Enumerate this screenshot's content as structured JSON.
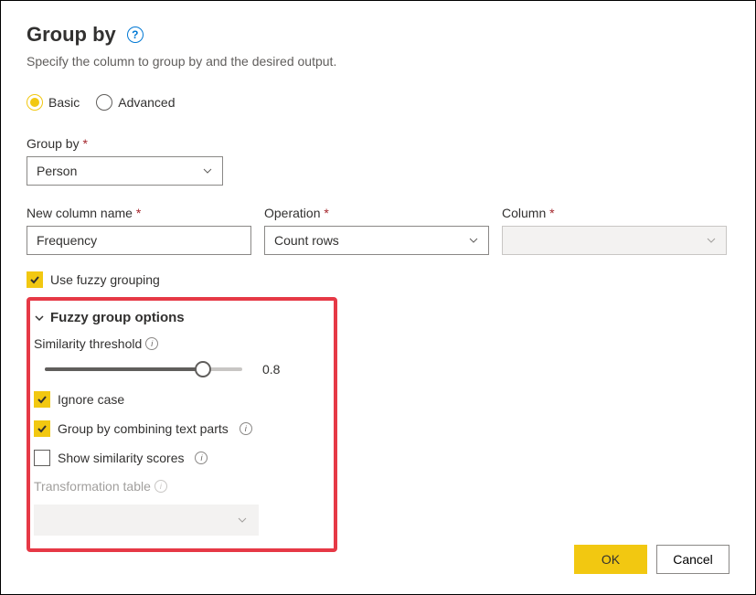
{
  "title": "Group by",
  "subtitle": "Specify the column to group by and the desired output.",
  "mode": {
    "basic": "Basic",
    "advanced": "Advanced"
  },
  "groupByLabel": "Group by",
  "groupByValue": "Person",
  "newColumn": {
    "label": "New column name",
    "value": "Frequency"
  },
  "operation": {
    "label": "Operation",
    "value": "Count rows"
  },
  "column": {
    "label": "Column",
    "value": ""
  },
  "useFuzzy": "Use fuzzy grouping",
  "fuzzy": {
    "header": "Fuzzy group options",
    "similarityLabel": "Similarity threshold",
    "similarityValue": "0.8",
    "ignoreCase": "Ignore case",
    "combineText": "Group by combining text parts",
    "showScores": "Show similarity scores",
    "transformLabel": "Transformation table"
  },
  "buttons": {
    "ok": "OK",
    "cancel": "Cancel"
  }
}
